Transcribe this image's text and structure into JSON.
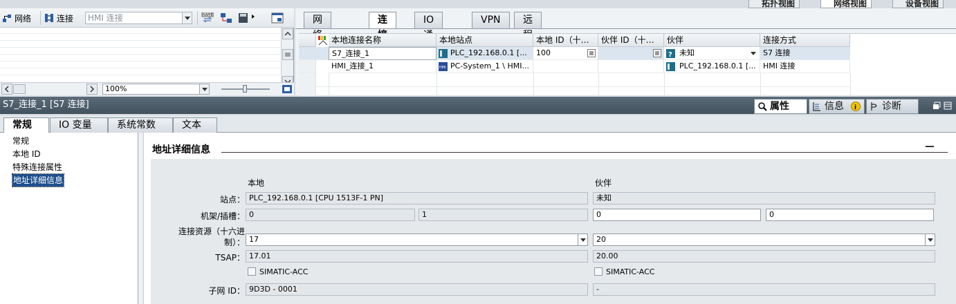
{
  "network_toolbar": {
    "network_label": "网络",
    "connection_label": "连接",
    "connection_type_value": "HMI 连接",
    "zoom_value": "100%"
  },
  "view_tabs": [
    "拓扑视图",
    "网络视图",
    "设备视图"
  ],
  "top_tabs": [
    "网络概览",
    "连接",
    "IO 通信",
    "VPN",
    "远程控制"
  ],
  "active_top_tab": "连接",
  "connection_table": {
    "columns": [
      "本地连接名称",
      "本地站点",
      "本地 ID（十…",
      "伙伴 ID（十…",
      "伙伴",
      "连接方式"
    ],
    "rows": [
      {
        "name": "S7_连接_1",
        "local_station": "PLC_192.168.0.1 [...",
        "local_id": "100",
        "partner_id": "",
        "partner": "未知",
        "type": "S7 连接"
      },
      {
        "name": "HMI_连接_1",
        "local_station": "PC-System_1 \\ HMI...",
        "local_id": "",
        "partner_id": "",
        "partner": "PLC_192.168.0.1 [...",
        "type": "HMI 连接"
      }
    ]
  },
  "properties": {
    "title": "S7_连接_1 [S7 连接]",
    "right_tabs": [
      "属性",
      "信息",
      "诊断"
    ],
    "sub_tabs": [
      "常规",
      "IO 变量",
      "系统常数",
      "文本"
    ],
    "nav_items": [
      "常规",
      "本地 ID",
      "特殊连接属性",
      "地址详细信息"
    ],
    "section_title": "地址详细信息",
    "col_local": "本地",
    "col_partner": "伙伴",
    "labels": {
      "station": "站点：",
      "rack_slot": "机架/插槽：",
      "conn_resource_1": "连接资源（十六进",
      "conn_resource_2": "制）：",
      "tsap": "TSAP：",
      "subnet_id": "子网 ID："
    },
    "local": {
      "station": "PLC_192.168.0.1 [CPU 1513F-1 PN]",
      "rack": "0",
      "slot": "1",
      "conn_resource": "17",
      "tsap": "17.01",
      "simatic_acc": "SIMATIC-ACC",
      "subnet_id": "9D3D - 0001"
    },
    "partner": {
      "station": "未知",
      "rack": "0",
      "slot": "0",
      "conn_resource": "20",
      "tsap": "20.00",
      "simatic_acc": "SIMATIC-ACC",
      "subnet_id": "-"
    }
  }
}
